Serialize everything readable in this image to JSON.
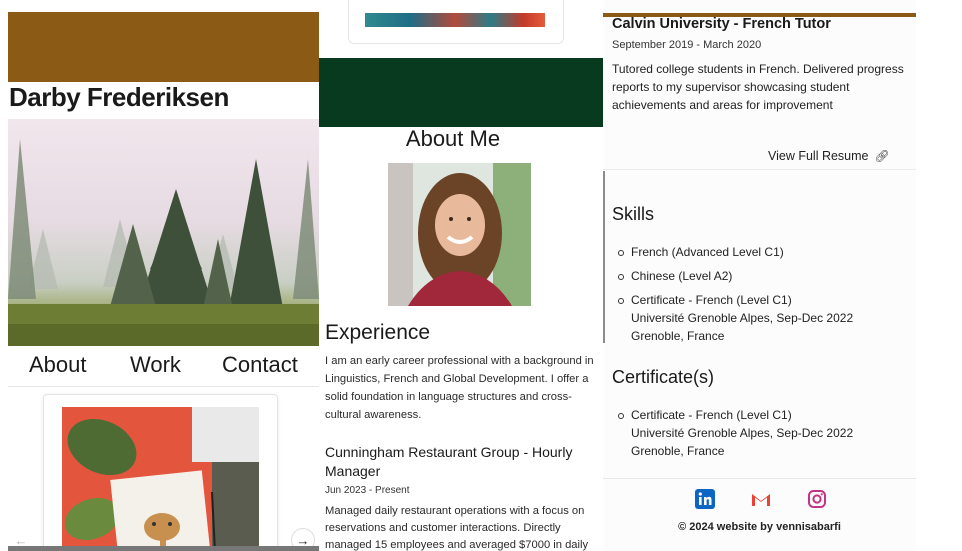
{
  "left": {
    "name": "Darby Frederiksen",
    "nav": [
      {
        "label": "About"
      },
      {
        "label": "Work"
      },
      {
        "label": "Contact"
      }
    ],
    "carousel": {
      "prev_icon": "arrow-left-icon",
      "next_icon": "arrow-right-icon"
    },
    "colors": {
      "header_bar": "#8b5a14"
    }
  },
  "middle": {
    "about_title": "About Me",
    "experience_title": "Experience",
    "experience_text": "I am an early career professional with a background in Linguistics, French and Global Development. I offer a solid foundation in language structures and cross-cultural awareness.",
    "job": {
      "title": "Cunningham Restaurant Group - Hourly Manager",
      "dates": "Jun 2023 - Present",
      "description": "Managed daily restaurant operations with a focus on reservations and customer interactions. Directly managed 15 employees and averaged $7000 in daily"
    },
    "colors": {
      "banner": "#073a1f"
    }
  },
  "right": {
    "job": {
      "title": "Calvin University - French Tutor",
      "dates": "September 2019 - March 2020",
      "description": "Tutored college students in French. Delivered progress reports to my supervisor showcasing student achievements and areas for improvement"
    },
    "resume_link": "View Full Resume",
    "resume_icon": "link-icon",
    "skills_title": "Skills",
    "skills": [
      {
        "text": "French (Advanced Level C1)"
      },
      {
        "text": "Chinese (Level A2)"
      },
      {
        "text": "Certificate - French (Level C1)\nUniversité Grenoble Alpes, Sep-Dec 2022\nGrenoble, France"
      }
    ],
    "certs_title": "Certificate(s)",
    "certs": [
      {
        "text": "Certificate - French (Level C1)\nUniversité Grenoble Alpes, Sep-Dec 2022\nGrenoble, France"
      }
    ],
    "socials": [
      {
        "icon": "linkedin-icon",
        "color": "#0a66c2"
      },
      {
        "icon": "gmail-icon",
        "color": "#ea4335"
      },
      {
        "icon": "instagram-icon",
        "color": "#c13584"
      }
    ],
    "copyright": "© 2024 website by vennisabarfi"
  }
}
